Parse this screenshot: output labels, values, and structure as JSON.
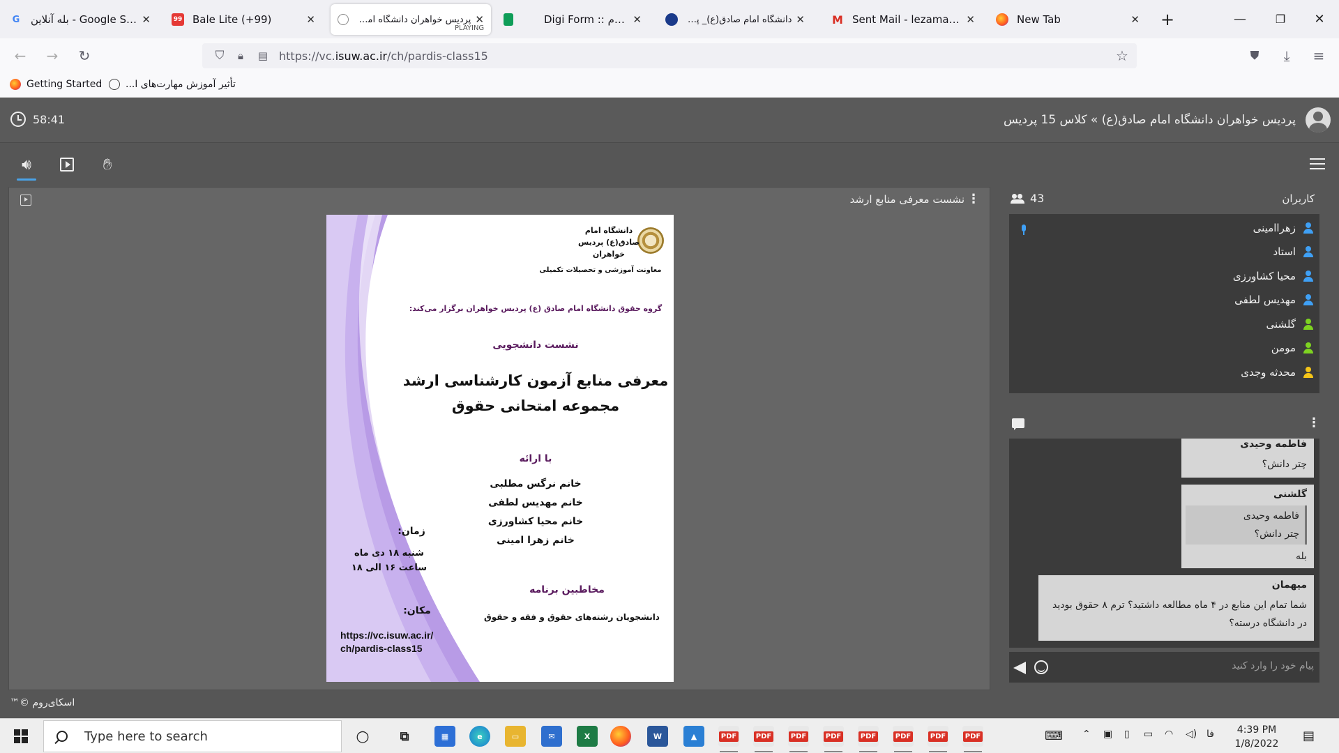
{
  "browser": {
    "tabs": [
      {
        "title": "بله آنلاین - Google Search",
        "favicon": "google-icon"
      },
      {
        "title": "Bale Lite (+99)",
        "favicon": "bale-icon"
      },
      {
        "title": "پردیس خواهران دانشگاه امام صا",
        "subtitle": "PLAYING",
        "favicon": "globe-icon",
        "active": true
      },
      {
        "title": "",
        "favicon": "sheets-icon"
      },
      {
        "title": "Digi Form :: دیجی فرم",
        "favicon": "digiform-icon"
      },
      {
        "title": "دانشگاه امام صادق(ع)_ پردیس ...",
        "favicon": "university-icon"
      },
      {
        "title": "Sent Mail - lezamani@gr",
        "favicon": "gmail-icon"
      },
      {
        "title": "New Tab",
        "favicon": "firefox-icon"
      }
    ],
    "url_prefix": "https://vc.",
    "url_domain": "isuw.ac.ir",
    "url_path": "/ch/pardis-class15",
    "bookmarks": [
      "Getting Started",
      "تأثیر آموزش مهارت‌های ا..."
    ]
  },
  "app": {
    "timer": "58:41",
    "room_title": "پردیس خواهران دانشگاه امام صادق(ع) » کلاس 15 پردیس",
    "presentation_label": "نشست معرفی منابع ارشد",
    "footer": "اسکای‌روم ©™"
  },
  "poster": {
    "university": "دانشگاه امام صادق(ع) پردیس خواهران",
    "deputy": "معاونت آموزشی و تحصیلات تکمیلی",
    "group": "گروه حقوق دانشگاه امام صادق (ع) پردیس خواهران برگزار می‌کند:",
    "session": "نشست دانشجویی",
    "main_title": "معرفی منابع آزمون کارشناسی ارشد مجموعه امتحانی حقوق",
    "with_label": "با ارائه",
    "presenters": "خانم نرگس مطلبی\nخانم مهدیس لطفی\nخانم محیا کشاورزی\nخانم زهرا امینی",
    "time_label": "زمان:",
    "time": "شنبه ۱۸ دی ماه ساعت ۱۶ الی ۱۸",
    "audience_label": "مخاطبین برنامه",
    "audience": "دانشجویان رشته‌های حقوق و فقه و حقوق",
    "place_label": "مکان:",
    "link": "https://vc.isuw.ac.ir/ ch/pardis-class15"
  },
  "users": {
    "title": "کاربران",
    "count": "43",
    "list": [
      {
        "name": "زهراامینی",
        "color": "#3fa0f5",
        "mic": true
      },
      {
        "name": "استاد",
        "color": "#3fa0f5"
      },
      {
        "name": "محیا کشاورزی",
        "color": "#3fa0f5"
      },
      {
        "name": "مهدیس لطفی",
        "color": "#3fa0f5"
      },
      {
        "name": "گلشنی",
        "color": "#7ed321"
      },
      {
        "name": "مومن",
        "color": "#7ed321"
      },
      {
        "name": "محدثه وجدی",
        "color": "#f5c518"
      }
    ]
  },
  "chat": {
    "messages": [
      {
        "sender": "فاطمه وحیدی",
        "text": "چتر دانش؟"
      },
      {
        "sender": "گلشنی",
        "quote_sender": "فاطمه وحیدی",
        "quote_text": "چتر دانش؟",
        "text": "بله"
      },
      {
        "sender": "میهمان",
        "text": "شما تمام این منابع در ۴ ماه مطالعه داشتید؟ ترم ۸ حقوق بودید در دانشگاه درسته؟"
      }
    ],
    "placeholder": "پیام خود را وارد کنید"
  },
  "taskbar": {
    "search_placeholder": "Type here to search",
    "language": "فا",
    "time": "4:39 PM",
    "date": "1/8/2022"
  }
}
